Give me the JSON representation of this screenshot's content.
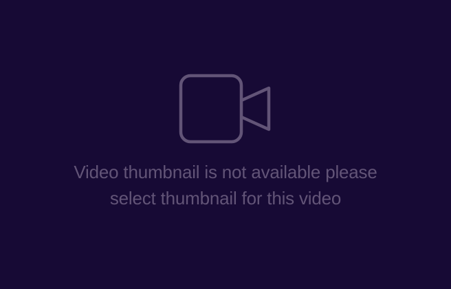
{
  "placeholder": {
    "icon": "video-camera-icon",
    "message_line_1": "Video thumbnail is not available please",
    "message_line_2": "select thumbnail for this video",
    "colors": {
      "background": "#170a35",
      "foreground": "#625477"
    }
  }
}
